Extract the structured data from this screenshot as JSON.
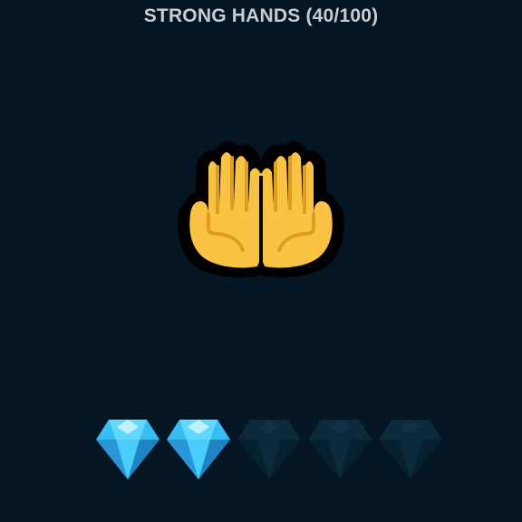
{
  "title": {
    "label": "STRONG HANDS",
    "score": 40,
    "max": 100,
    "text": "STRONG HANDS (40/100)"
  },
  "emoji": {
    "icon": "palms-up-together-icon"
  },
  "rating": {
    "filled": 2,
    "total": 5,
    "icon": "gem-icon"
  },
  "colors": {
    "background": "#041524",
    "title_text": "#c9cdd1",
    "hand_fill": "#fbc343",
    "hand_outline": "#000000",
    "hand_line": "#df9d1f",
    "gem_light": "#63d8ff",
    "gem_mid": "#38bdf2",
    "gem_dark": "#2a96d8",
    "gem_top": "#bff0ff",
    "gem_empty": "#0b2a3b",
    "gem_empty_dark": "#072030"
  }
}
